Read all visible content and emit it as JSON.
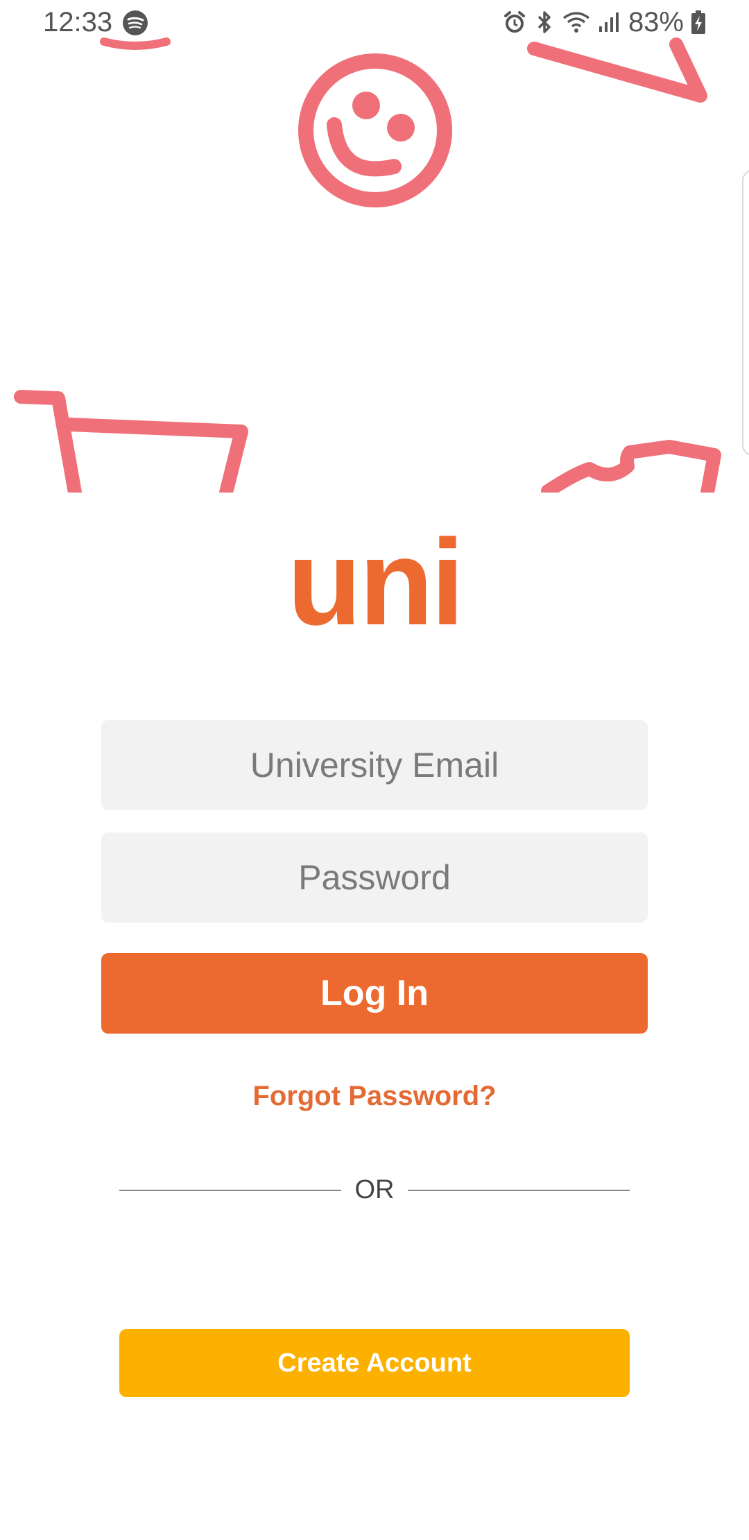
{
  "status_bar": {
    "time": "12:33",
    "battery_percent": "83%",
    "icons": [
      "spotify-icon",
      "alarm-icon",
      "bluetooth-icon",
      "wifi-icon",
      "signal-icon",
      "battery-charging-icon"
    ]
  },
  "hero": {
    "illustrations": [
      "smiley-face-icon",
      "shopping-cart-icon",
      "paper-plane-icon",
      "wave-icon"
    ],
    "accent_color": "#ef7078"
  },
  "logo": {
    "text": "uni",
    "color": "#ec6a2f"
  },
  "login_form": {
    "email_placeholder": "University Email",
    "email_value": "",
    "password_placeholder": "Password",
    "password_value": "",
    "login_label": "Log In",
    "forgot_label": "Forgot Password?"
  },
  "divider": {
    "label": "OR"
  },
  "signup": {
    "create_label": "Create Account",
    "color": "#fcb000"
  }
}
